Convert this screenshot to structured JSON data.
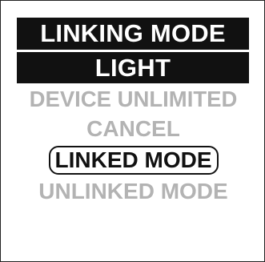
{
  "screen": {
    "title": "LINKING MODE",
    "menu": {
      "selected_value": "LIGHT",
      "items": [
        "DEVICE UNLIMITED",
        "CANCEL",
        "LINKED MODE",
        "UNLINKED MODE"
      ],
      "highlighted_item": "LINKED MODE"
    }
  },
  "colors": {
    "bar_background": "#111111",
    "bar_text": "#ffffff",
    "inactive_text": "#b3b3b3",
    "highlight_text": "#111111",
    "background": "#ffffff"
  }
}
